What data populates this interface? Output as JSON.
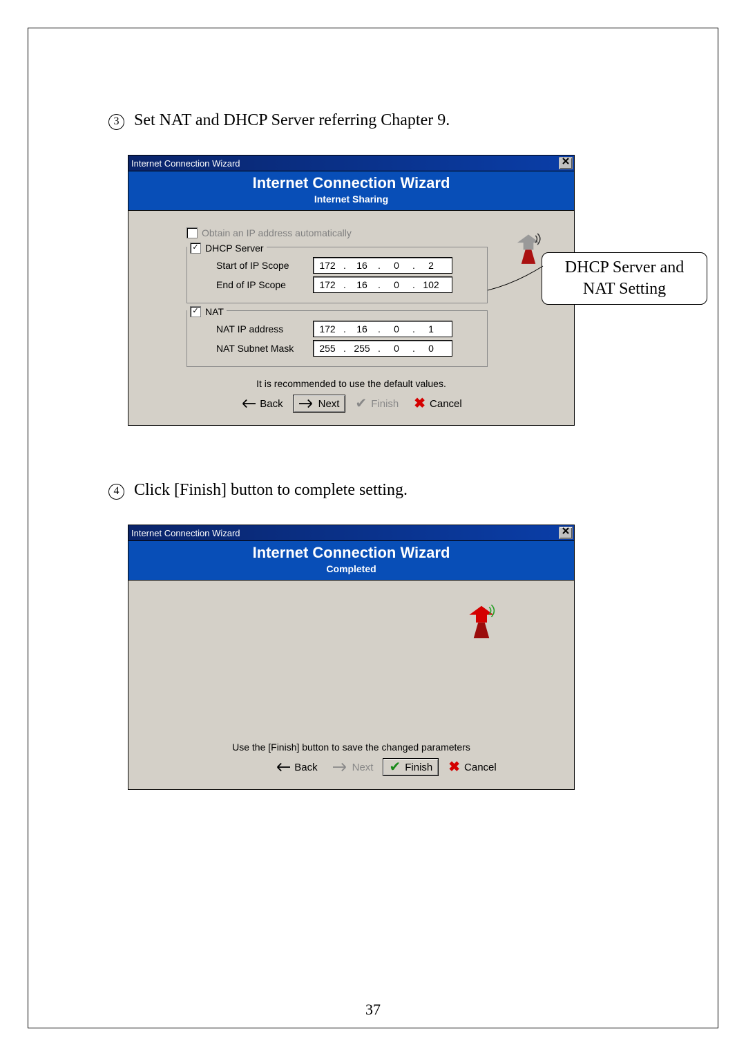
{
  "page_number": "37",
  "step3": {
    "marker": "3",
    "text": "Set NAT and DHCP Server referring Chapter 9."
  },
  "step4": {
    "marker": "4",
    "text": "Click [Finish] button to complete setting."
  },
  "callout": {
    "line1": "DHCP Server and",
    "line2": "NAT Setting"
  },
  "wizard1": {
    "titlebar": "Internet Connection Wizard",
    "banner_title": "Internet Connection Wizard",
    "banner_sub": "Internet Sharing",
    "auto_ip_label": "Obtain an IP address automatically",
    "dhcp_label": "DHCP Server",
    "nat_label": "NAT",
    "start_scope_label": "Start of IP Scope",
    "end_scope_label": "End of IP Scope",
    "nat_ip_label": "NAT IP address",
    "nat_mask_label": "NAT Subnet Mask",
    "start_ip": {
      "a": "172",
      "b": "16",
      "c": "0",
      "d": "2"
    },
    "end_ip": {
      "a": "172",
      "b": "16",
      "c": "0",
      "d": "102"
    },
    "nat_ip": {
      "a": "172",
      "b": "16",
      "c": "0",
      "d": "1"
    },
    "nat_mask": {
      "a": "255",
      "b": "255",
      "c": "0",
      "d": "0"
    },
    "hint": "It is recommended to use the default values.",
    "buttons": {
      "back": "Back",
      "next": "Next",
      "finish": "Finish",
      "cancel": "Cancel"
    }
  },
  "wizard2": {
    "titlebar": "Internet Connection Wizard",
    "banner_title": "Internet Connection Wizard",
    "banner_sub": "Completed",
    "hint": "Use the [Finish] button to save the changed parameters",
    "buttons": {
      "back": "Back",
      "next": "Next",
      "finish": "Finish",
      "cancel": "Cancel"
    }
  }
}
